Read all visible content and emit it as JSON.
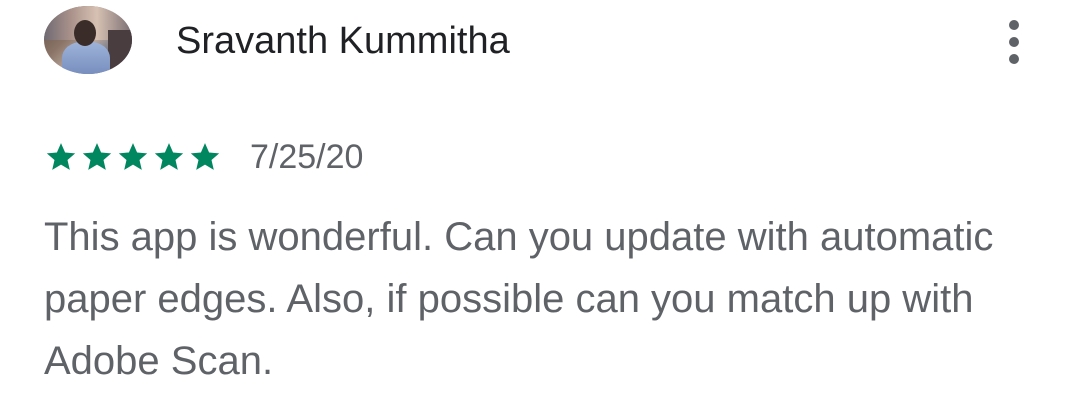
{
  "review": {
    "author": "Sravanth Kummitha",
    "avatar_icon": "user-photo",
    "more_icon": "more-vert-icon",
    "rating": 5,
    "rating_max": 5,
    "star_color": "#01875f",
    "date": "7/25/20",
    "text": "This app is wonderful. Can you update with automatic paper edges. Also, if possible can you match up with Adobe Scan."
  }
}
